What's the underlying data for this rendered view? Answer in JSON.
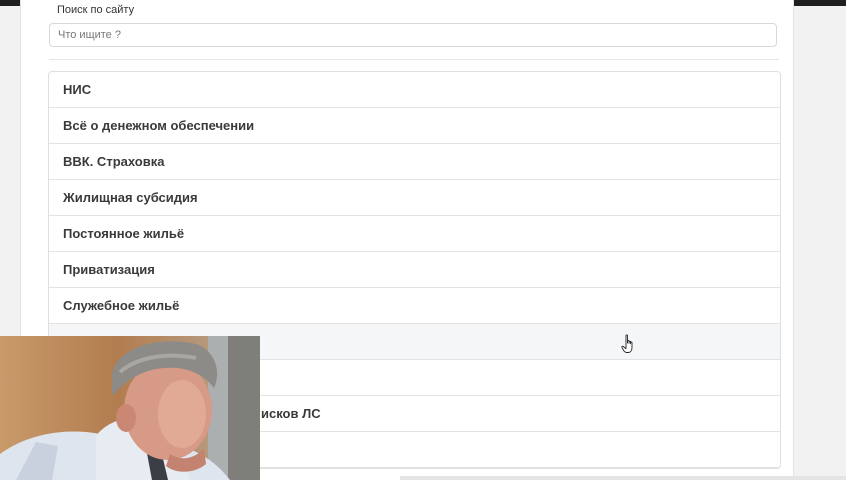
{
  "search": {
    "label": "Поиск по сайту",
    "placeholder": "Что ищите ?"
  },
  "menu": {
    "items": [
      {
        "label": "НИС"
      },
      {
        "label": "Всё о денежном обеспечении"
      },
      {
        "label": "ВВК. Страховка"
      },
      {
        "label": "Жилищная субсидия"
      },
      {
        "label": "Постоянное жильё"
      },
      {
        "label": "Приватизация"
      },
      {
        "label": "Служебное жильё"
      },
      {
        "label": ""
      },
      {
        "label": ""
      },
      {
        "label": "исков ЛС"
      },
      {
        "label": ""
      }
    ]
  },
  "icons": {
    "cursor": "hand-pointer-icon"
  },
  "colors": {
    "page_background": "#ffffff",
    "outer_background": "#f2f2f2",
    "hover_row": "#f5f6f7",
    "text": "#3a3a3a"
  }
}
